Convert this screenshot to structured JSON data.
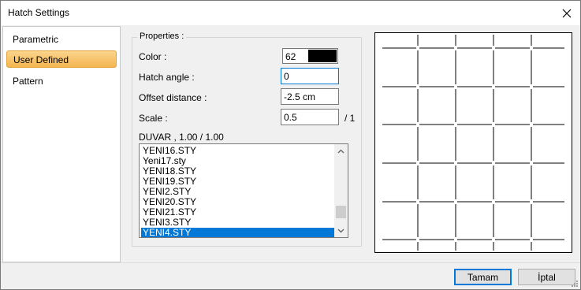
{
  "window": {
    "title": "Hatch Settings"
  },
  "nav": {
    "items": [
      {
        "label": "Parametric"
      },
      {
        "label": "User Defined",
        "selected": true
      },
      {
        "label": "Pattern"
      }
    ]
  },
  "properties": {
    "legend": "Properties :",
    "color_label": "Color :",
    "color_value": "62",
    "color_swatch": "#000000",
    "hatch_angle_label": "Hatch angle :",
    "hatch_angle_value": "0",
    "offset_label": "Offset distance :",
    "offset_value": "-2.5 cm",
    "scale_label": "Scale :",
    "scale_value": "0.5",
    "scale_unit": "/ 1",
    "style_info": "DUVAR , 1.00 / 1.00",
    "styles": [
      "YENI16.STY",
      "Yeni17.sty",
      "YENI18.STY",
      "YENI19.STY",
      "YENI2.STY",
      "YENI20.STY",
      "YENI21.STY",
      "YENI3.STY",
      "YENI4.STY"
    ],
    "selected_style": "YENI4.STY"
  },
  "buttons": {
    "ok": "Tamam",
    "cancel": "İptal"
  },
  "icons": {
    "close": "close-icon",
    "scroll_up": "chevron-up-icon",
    "scroll_down": "chevron-down-icon",
    "resize": "resize-grip-icon"
  },
  "colors": {
    "accent": "#0078d7",
    "nav_selected": "#f4b650"
  }
}
